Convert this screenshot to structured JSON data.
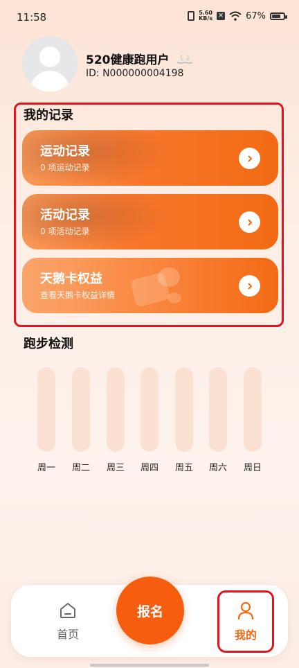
{
  "status_bar": {
    "time": "11:58",
    "net_speed_value": "5.60",
    "net_speed_unit": "KB/s",
    "battery": "67%",
    "battery_level": 0.67
  },
  "profile": {
    "username": "520健康跑用户",
    "user_id": "ID: N000000004198"
  },
  "records": {
    "title": "我的记录",
    "cards": [
      {
        "title": "运动记录",
        "subtitle": "0 项运动记录"
      },
      {
        "title": "活动记录",
        "subtitle": "0 项活动记录"
      },
      {
        "title": "天鹅卡权益",
        "subtitle": "查看天鹅卡权益详情"
      }
    ]
  },
  "run_check": {
    "title": "跑步检测",
    "days": [
      "周一",
      "周二",
      "周三",
      "周四",
      "周五",
      "周六",
      "周日"
    ]
  },
  "nav": {
    "home_label": "首页",
    "signup_label": "报名",
    "mine_label": "我的"
  },
  "colors": {
    "accent": "#f65d0f",
    "highlight_border": "#e0141f"
  }
}
